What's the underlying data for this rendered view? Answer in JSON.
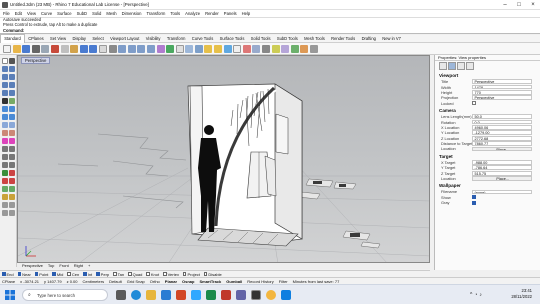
{
  "window": {
    "title": "Untitled.3dm (23 MB) - Rhino 7 Educational Lab License - [Perspective]"
  },
  "menu": [
    "File",
    "Edit",
    "View",
    "Curve",
    "Surface",
    "SubD",
    "Solid",
    "Mesh",
    "Dimension",
    "Transform",
    "Tools",
    "Analyze",
    "Render",
    "Panels",
    "Help"
  ],
  "command": {
    "history": [
      "Autosave succeeded",
      "Press Control to extrude, tap Alt to make a duplicate"
    ],
    "prompt": "Command:"
  },
  "toolbar_tabs": [
    "Standard",
    "CPlanes",
    "Set View",
    "Display",
    "Select",
    "Viewport Layout",
    "Visibility",
    "Transform",
    "Curve Tools",
    "Surface Tools",
    "Solid Tools",
    "SubD Tools",
    "Mesh Tools",
    "Render Tools",
    "Drafting",
    "New in V7"
  ],
  "active_tab": "Standard",
  "viewport": {
    "label": "Perspective",
    "tabs": [
      "Perspective",
      "Top",
      "Front",
      "Right"
    ]
  },
  "osnap": [
    {
      "label": "End",
      "on": true
    },
    {
      "label": "Near",
      "on": true
    },
    {
      "label": "Point",
      "on": true
    },
    {
      "label": "Mid",
      "on": true
    },
    {
      "label": "Cen",
      "on": false
    },
    {
      "label": "Int",
      "on": true
    },
    {
      "label": "Perp",
      "on": true
    },
    {
      "label": "Tan",
      "on": false
    },
    {
      "label": "Quad",
      "on": false
    },
    {
      "label": "Knot",
      "on": false
    },
    {
      "label": "Vertex",
      "on": false
    },
    {
      "label": "Project",
      "on": false
    },
    {
      "label": "Disable",
      "on": false
    }
  ],
  "status": {
    "cplane": "CPlane",
    "x": "x -3074.21",
    "y": "y 1407.79",
    "z": "z 0.00",
    "units": "Centimeters",
    "layer": "Default",
    "toggles": [
      "Grid Snap",
      "Ortho",
      "Planar",
      "Osnap",
      "SmartTrack",
      "Gumball",
      "Record History",
      "Filter"
    ],
    "message": "Minutes from last save: 77"
  },
  "panel": {
    "tabs": [
      "Properties: View properties"
    ],
    "sections": {
      "viewport": {
        "title": "Viewport",
        "rows": [
          {
            "k": "Title",
            "v": "Perspective"
          },
          {
            "k": "Width",
            "v": "1478"
          },
          {
            "k": "Height",
            "v": "770"
          },
          {
            "k": "Projection",
            "v": "Perspective"
          },
          {
            "k": "Locked",
            "v": ""
          }
        ]
      },
      "camera": {
        "title": "Camera",
        "rows": [
          {
            "k": "Lens Length(mm)",
            "v": "50.0"
          },
          {
            "k": "Rotation",
            "v": "0.0"
          },
          {
            "k": "X Location",
            "v": "4960.06"
          },
          {
            "k": "Y Location",
            "v": "-1279.00"
          },
          {
            "k": "Z Location",
            "v": "2772.68"
          },
          {
            "k": "Distance to Target",
            "v": "7860.77"
          },
          {
            "k": "Location",
            "v": "Place..."
          }
        ]
      },
      "target": {
        "title": "Target",
        "rows": [
          {
            "k": "X Target",
            "v": "-988.00"
          },
          {
            "k": "Y Target",
            "v": "-786.64"
          },
          {
            "k": "Z Target",
            "v": "515.75"
          },
          {
            "k": "Location",
            "v": "Place..."
          }
        ]
      },
      "wallpaper": {
        "title": "Wallpaper",
        "rows": [
          {
            "k": "Filename",
            "v": "(none)"
          },
          {
            "k": "Show",
            "v": ""
          },
          {
            "k": "Gray",
            "v": ""
          }
        ]
      }
    }
  },
  "taskbar": {
    "search": "Type here to search",
    "time": "23:41",
    "date": "28/11/2022"
  },
  "colors": {
    "accent": "#2a5db0",
    "viewport_bg": "#c3c5c7"
  }
}
